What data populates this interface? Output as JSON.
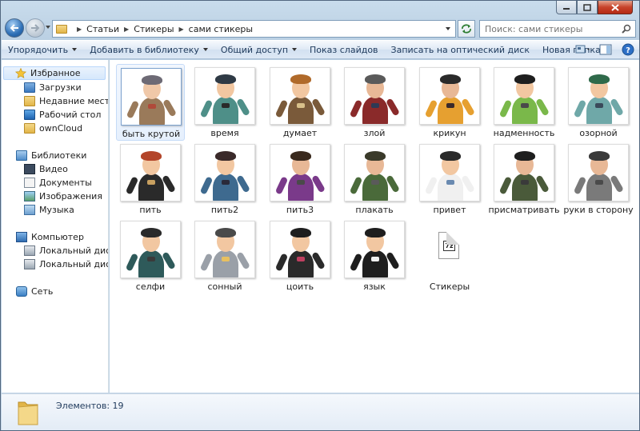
{
  "window": {
    "caption_buttons": [
      "minimize-icon",
      "maximize-icon",
      "close-icon"
    ]
  },
  "navbar": {
    "breadcrumb": [
      "Статьи",
      "Стикеры",
      "сами стикеры"
    ],
    "search_placeholder": "Поиск: сами стикеры"
  },
  "toolbar": {
    "organize": "Упорядочить",
    "add_to_library": "Добавить в библиотеку",
    "share": "Общий доступ",
    "slideshow": "Показ слайдов",
    "burn": "Записать на оптический диск",
    "new_folder": "Новая папка"
  },
  "navpane": {
    "favorites": "Избранное",
    "favorites_items": [
      "Загрузки",
      "Недавние места",
      "Рабочий стол",
      "ownCloud"
    ],
    "libraries": "Библиотеки",
    "libraries_items": [
      "Видео",
      "Документы",
      "Изображения",
      "Музыка"
    ],
    "computer": "Компьютер",
    "computer_items": [
      "Локальный диск (C",
      "Локальный диск (D"
    ],
    "network": "Сеть"
  },
  "files": [
    {
      "name": "быть крутой",
      "selected": true,
      "palette": [
        "#6d6a75",
        "#9a7a5a",
        "#f0c8a8",
        "#b04a3a"
      ]
    },
    {
      "name": "время",
      "palette": [
        "#2f3a45",
        "#4e8f88",
        "#f2c7a1",
        "#2a2a2a"
      ]
    },
    {
      "name": "думает",
      "palette": [
        "#b06a2a",
        "#7a5a3a",
        "#f2c7a1",
        "#d8c08a"
      ]
    },
    {
      "name": "злой",
      "palette": [
        "#5a5a5a",
        "#8a2a2a",
        "#e8b896",
        "#2e3a55"
      ]
    },
    {
      "name": "крикун",
      "palette": [
        "#2a2a2a",
        "#e6a030",
        "#e8b896",
        "#3a2a2a"
      ]
    },
    {
      "name": "надменность",
      "palette": [
        "#1e1e1e",
        "#7ab84a",
        "#f2c7a1",
        "#4a4a4a"
      ]
    },
    {
      "name": "озорной",
      "palette": [
        "#2f6a4a",
        "#6fa8a8",
        "#f2c7a1",
        "#3a4a5a"
      ]
    },
    {
      "name": "пить",
      "palette": [
        "#b3452a",
        "#2a2a2a",
        "#f2c7a1",
        "#c8a060"
      ]
    },
    {
      "name": "пить2",
      "palette": [
        "#3a2a2a",
        "#3e6a8f",
        "#f2c7a1",
        "#2a2a3a"
      ]
    },
    {
      "name": "пить3",
      "palette": [
        "#3a2a1e",
        "#7a3a8a",
        "#e8b896",
        "#4a4a4a"
      ]
    },
    {
      "name": "плакать",
      "palette": [
        "#3a3a2a",
        "#4a6a3a",
        "#e8b896",
        "#5a5a5a"
      ]
    },
    {
      "name": "привет",
      "palette": [
        "#2a2a2a",
        "#f0f0f0",
        "#f2c7a1",
        "#6a8ab0"
      ]
    },
    {
      "name": "присматривать",
      "palette": [
        "#1e1e1e",
        "#4a5a3a",
        "#e8b896",
        "#3a3a3a"
      ]
    },
    {
      "name": "руки в сторону",
      "palette": [
        "#3a3a3a",
        "#7a7a7a",
        "#e8b896",
        "#4a4a4a"
      ]
    },
    {
      "name": "селфи",
      "palette": [
        "#2a2a2a",
        "#2e5a5a",
        "#f2c7a1",
        "#3a3a3a"
      ]
    },
    {
      "name": "сонный",
      "palette": [
        "#4a4a4a",
        "#9aa0a8",
        "#f2c7a1",
        "#e8c060"
      ]
    },
    {
      "name": "цоить",
      "palette": [
        "#1e1e1e",
        "#2a2a2a",
        "#f2c7a1",
        "#c04060"
      ]
    },
    {
      "name": "язык",
      "palette": [
        "#1e1e1e",
        "#1e1e1e",
        "#f2c7a1",
        "#f0f0f0"
      ]
    },
    {
      "name": "Стикеры",
      "type": "archive",
      "icon": "7z-archive-icon"
    }
  ],
  "details": {
    "count_label": "Элементов: 19"
  },
  "colors": {
    "accent": "#1e395b",
    "selection": "#d5e7fb"
  }
}
